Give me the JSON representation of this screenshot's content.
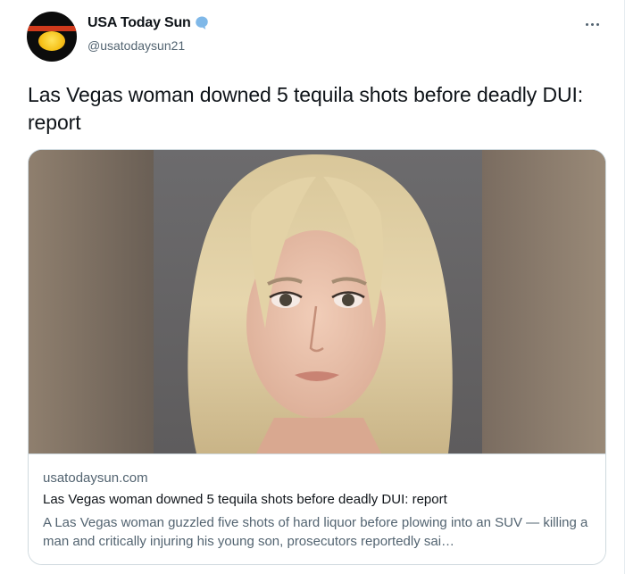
{
  "author": {
    "display_name": "USA Today Sun",
    "handle": "@usatodaysun21",
    "verified": true,
    "verified_color": "#1d9bf0"
  },
  "tweet": {
    "text": "Las Vegas woman downed 5 tequila shots before deadly DUI: report"
  },
  "link_card": {
    "domain": "usatodaysun.com",
    "title": "Las Vegas woman downed 5 tequila shots before deadly DUI: report",
    "description": "A Las Vegas woman guzzled five shots of hard liquor before plowing into an SUV — killing a man and critically injuring his young son, prosecutors reportedly sai…",
    "image_icon": "mugshot-photo"
  },
  "icons": {
    "more": "more-horizontal-icon",
    "verified": "verified-badge-icon",
    "avatar": "sun-logo-avatar"
  }
}
